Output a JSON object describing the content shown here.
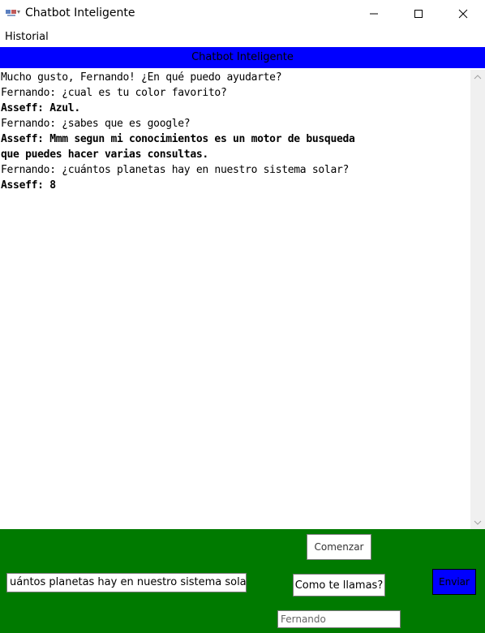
{
  "window": {
    "title": "Chatbot Inteligente",
    "app_icon": "chat-app-icon"
  },
  "menu": {
    "items": [
      "Historial"
    ]
  },
  "header": {
    "title": "Chatbot Inteligente",
    "background": "#0000ff"
  },
  "chat": {
    "lines": [
      {
        "speaker": "bot",
        "text": "Mucho gusto, Fernando! ¿En qué puedo ayudarte?"
      },
      {
        "speaker": "user",
        "text": "Fernando: ¿cual es tu color favorito?"
      },
      {
        "speaker": "bot",
        "text": "Asseff: Azul."
      },
      {
        "speaker": "user",
        "text": "Fernando: ¿sabes que es google?"
      },
      {
        "speaker": "bot",
        "text": "Asseff: Mmm segun mi conocimientos es un motor de busqueda"
      },
      {
        "speaker": "bot",
        "text": "que puedes hacer varias consultas."
      },
      {
        "speaker": "user",
        "text": "Fernando: ¿cuántos planetas hay en nuestro sistema solar?"
      },
      {
        "speaker": "bot",
        "text": "Asseff: 8"
      }
    ]
  },
  "controls": {
    "start_label": "Comenzar",
    "name_label": "Como te llamas?",
    "send_label": "Enviar",
    "message_value": "uántos planetas hay en nuestro sistema solar?",
    "name_value": "Fernando"
  },
  "colors": {
    "panel": "#007a00",
    "send_button": "#0000ff"
  }
}
